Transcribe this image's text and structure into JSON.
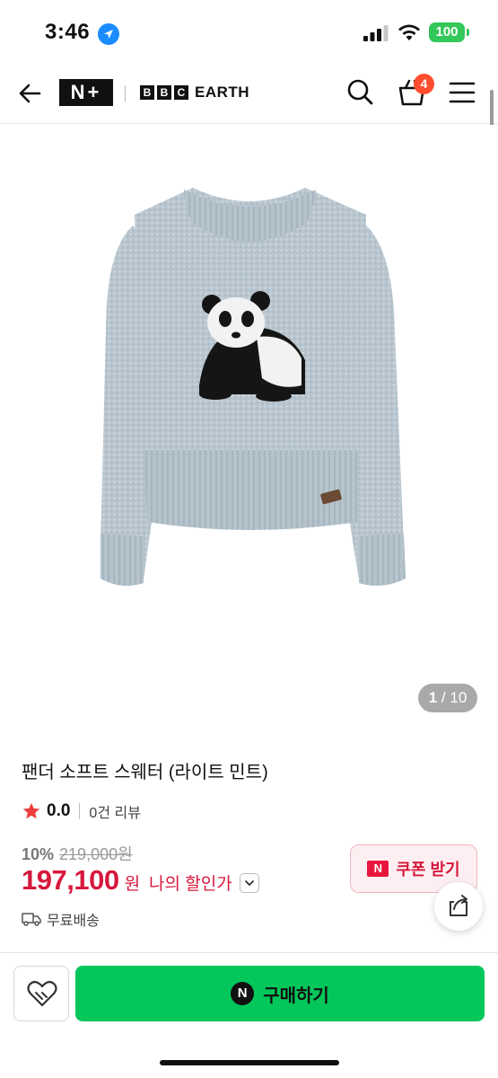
{
  "status_bar": {
    "time": "3:46",
    "battery": "100"
  },
  "header": {
    "brand_main": "N+",
    "brand_partner_boxes": [
      "B",
      "B",
      "C"
    ],
    "brand_partner_word": "EARTH",
    "cart_count": "4",
    "icons": [
      "back-arrow-icon",
      "search-icon",
      "shopping-bag-icon",
      "hamburger-menu-icon"
    ]
  },
  "gallery": {
    "current": "1",
    "total": "/ 10"
  },
  "product": {
    "title": "팬더 소프트 스웨터 (라이트 민트)",
    "rating": "0.0",
    "review_count": "0건 리뷰",
    "discount_rate": "10%",
    "original_price": "219,000원",
    "sale_price": "197,100",
    "price_unit": "원",
    "my_discount_label": "나의 할인가",
    "shipping": "무료배송"
  },
  "coupon": {
    "badge": "N",
    "label": "쿠폰 받기"
  },
  "bottom_bar": {
    "buy_badge": "N",
    "buy_label": "구매하기"
  },
  "colors": {
    "buy_green": "#03c75a",
    "price_red": "#d6183c",
    "star_red": "#ec3d3d",
    "cart_badge": "#ff4d2e",
    "sweater_blue": "#b9c6cf"
  }
}
